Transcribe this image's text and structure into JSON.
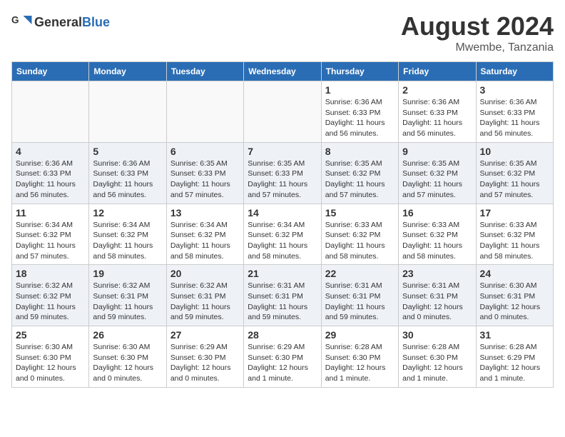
{
  "header": {
    "logo": {
      "general": "General",
      "blue": "Blue"
    },
    "title": "August 2024",
    "location": "Mwembe, Tanzania"
  },
  "weekdays": [
    "Sunday",
    "Monday",
    "Tuesday",
    "Wednesday",
    "Thursday",
    "Friday",
    "Saturday"
  ],
  "weeks": [
    {
      "days": [
        {
          "num": "",
          "empty": true
        },
        {
          "num": "",
          "empty": true
        },
        {
          "num": "",
          "empty": true
        },
        {
          "num": "",
          "empty": true
        },
        {
          "num": "1",
          "sunrise": "6:36 AM",
          "sunset": "6:33 PM",
          "daylight": "11 hours and 56 minutes."
        },
        {
          "num": "2",
          "sunrise": "6:36 AM",
          "sunset": "6:33 PM",
          "daylight": "11 hours and 56 minutes."
        },
        {
          "num": "3",
          "sunrise": "6:36 AM",
          "sunset": "6:33 PM",
          "daylight": "11 hours and 56 minutes."
        }
      ]
    },
    {
      "days": [
        {
          "num": "4",
          "sunrise": "6:36 AM",
          "sunset": "6:33 PM",
          "daylight": "11 hours and 56 minutes."
        },
        {
          "num": "5",
          "sunrise": "6:36 AM",
          "sunset": "6:33 PM",
          "daylight": "11 hours and 56 minutes."
        },
        {
          "num": "6",
          "sunrise": "6:35 AM",
          "sunset": "6:33 PM",
          "daylight": "11 hours and 57 minutes."
        },
        {
          "num": "7",
          "sunrise": "6:35 AM",
          "sunset": "6:33 PM",
          "daylight": "11 hours and 57 minutes."
        },
        {
          "num": "8",
          "sunrise": "6:35 AM",
          "sunset": "6:32 PM",
          "daylight": "11 hours and 57 minutes."
        },
        {
          "num": "9",
          "sunrise": "6:35 AM",
          "sunset": "6:32 PM",
          "daylight": "11 hours and 57 minutes."
        },
        {
          "num": "10",
          "sunrise": "6:35 AM",
          "sunset": "6:32 PM",
          "daylight": "11 hours and 57 minutes."
        }
      ]
    },
    {
      "days": [
        {
          "num": "11",
          "sunrise": "6:34 AM",
          "sunset": "6:32 PM",
          "daylight": "11 hours and 57 minutes."
        },
        {
          "num": "12",
          "sunrise": "6:34 AM",
          "sunset": "6:32 PM",
          "daylight": "11 hours and 58 minutes."
        },
        {
          "num": "13",
          "sunrise": "6:34 AM",
          "sunset": "6:32 PM",
          "daylight": "11 hours and 58 minutes."
        },
        {
          "num": "14",
          "sunrise": "6:34 AM",
          "sunset": "6:32 PM",
          "daylight": "11 hours and 58 minutes."
        },
        {
          "num": "15",
          "sunrise": "6:33 AM",
          "sunset": "6:32 PM",
          "daylight": "11 hours and 58 minutes."
        },
        {
          "num": "16",
          "sunrise": "6:33 AM",
          "sunset": "6:32 PM",
          "daylight": "11 hours and 58 minutes."
        },
        {
          "num": "17",
          "sunrise": "6:33 AM",
          "sunset": "6:32 PM",
          "daylight": "11 hours and 58 minutes."
        }
      ]
    },
    {
      "days": [
        {
          "num": "18",
          "sunrise": "6:32 AM",
          "sunset": "6:32 PM",
          "daylight": "11 hours and 59 minutes."
        },
        {
          "num": "19",
          "sunrise": "6:32 AM",
          "sunset": "6:31 PM",
          "daylight": "11 hours and 59 minutes."
        },
        {
          "num": "20",
          "sunrise": "6:32 AM",
          "sunset": "6:31 PM",
          "daylight": "11 hours and 59 minutes."
        },
        {
          "num": "21",
          "sunrise": "6:31 AM",
          "sunset": "6:31 PM",
          "daylight": "11 hours and 59 minutes."
        },
        {
          "num": "22",
          "sunrise": "6:31 AM",
          "sunset": "6:31 PM",
          "daylight": "11 hours and 59 minutes."
        },
        {
          "num": "23",
          "sunrise": "6:31 AM",
          "sunset": "6:31 PM",
          "daylight": "12 hours and 0 minutes."
        },
        {
          "num": "24",
          "sunrise": "6:30 AM",
          "sunset": "6:31 PM",
          "daylight": "12 hours and 0 minutes."
        }
      ]
    },
    {
      "days": [
        {
          "num": "25",
          "sunrise": "6:30 AM",
          "sunset": "6:30 PM",
          "daylight": "12 hours and 0 minutes."
        },
        {
          "num": "26",
          "sunrise": "6:30 AM",
          "sunset": "6:30 PM",
          "daylight": "12 hours and 0 minutes."
        },
        {
          "num": "27",
          "sunrise": "6:29 AM",
          "sunset": "6:30 PM",
          "daylight": "12 hours and 0 minutes."
        },
        {
          "num": "28",
          "sunrise": "6:29 AM",
          "sunset": "6:30 PM",
          "daylight": "12 hours and 1 minute."
        },
        {
          "num": "29",
          "sunrise": "6:28 AM",
          "sunset": "6:30 PM",
          "daylight": "12 hours and 1 minute."
        },
        {
          "num": "30",
          "sunrise": "6:28 AM",
          "sunset": "6:30 PM",
          "daylight": "12 hours and 1 minute."
        },
        {
          "num": "31",
          "sunrise": "6:28 AM",
          "sunset": "6:29 PM",
          "daylight": "12 hours and 1 minute."
        }
      ]
    }
  ]
}
